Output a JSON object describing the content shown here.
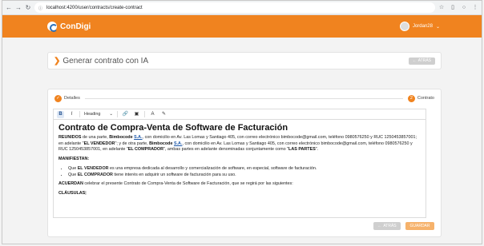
{
  "browser": {
    "url": "localhost:4200/user/contracts/create-contract"
  },
  "header": {
    "brand": "ConDigi",
    "user_name": "Jordan28"
  },
  "page": {
    "title": "Generar contrato con IA",
    "back_top_label": "ATRÁS"
  },
  "steps": [
    {
      "number": "1",
      "label": "Detalles"
    },
    {
      "number": "2",
      "label": "Contrato"
    }
  ],
  "toolbar": {
    "heading_label": "Heading"
  },
  "document": {
    "title": "Contrato de Compra-Venta de Software de Facturación",
    "p1": {
      "r1": "REUNIDOS",
      "r2": " de una parte, ",
      "r3": "Bimbocode",
      "r4": "S.A.",
      "r5": ", con domicilio en Av. Las Lomas y Santiago 405, con correo electrónico bimbocode@gmail.com, teléfono 0980576250 y RUC 1250453857001; en adelante \"",
      "r6": "EL VENDEDOR",
      "r7": "\"; y de otra parte, ",
      "r8": "Bimbocode",
      "r9": "S.A.",
      "r10": ", con domicilio en Av. Las Lomas y Santiago 405, con correo electrónico bimbocode@gmail.com, teléfono 0980576250 y RUC 1250453857001, en adelante \"",
      "r11": "EL COMPRADOR",
      "r12": "\", ambas partes en adelante denominadas conjuntamente como \"",
      "r13": "LAS PARTES",
      "r14": "\"."
    },
    "manifiestan": "MANIFIESTAN:",
    "li1": {
      "a": "Que ",
      "b": "EL VENDEDOR",
      "c": " es una empresa dedicada al desarrollo y comercialización de software, en especial, software de facturación."
    },
    "li2": {
      "a": "Que ",
      "b": "EL COMPRADOR",
      "c": " tiene interés en adquirir un software de facturación para su uso."
    },
    "acuerdan": {
      "a": "ACUERDAN",
      "b": " celebrar el presente Contrato de Compra-Venta de Software de Facturación, que se regirá por las siguientes:"
    },
    "clausulas": "CLÁUSULAS"
  },
  "footer": {
    "back_label": "ATRÁS",
    "save_label": "GUARDAR"
  },
  "colors": {
    "accent": "#f0831f",
    "link": "#1a56a8"
  }
}
